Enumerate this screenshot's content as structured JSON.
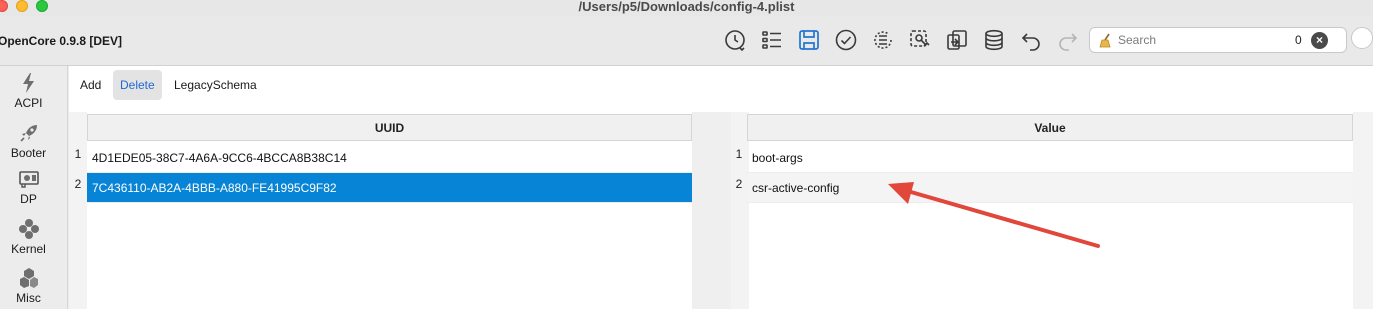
{
  "window": {
    "title": "/Users/p5/Downloads/config-4.plist"
  },
  "toolbar": {
    "app_title": "OpenCore 0.9.8 [DEV]",
    "icons": [
      "clock-icon",
      "list-icon",
      "save-icon",
      "check-icon",
      "list-check-icon",
      "search-config-icon",
      "export-icon",
      "database-icon",
      "undo-icon",
      "redo-icon"
    ],
    "search_placeholder": "Search",
    "search_count": "0",
    "clear_glyph": "×"
  },
  "sidebar": {
    "items": [
      {
        "label": "ACPI",
        "icon": "lightning-icon"
      },
      {
        "label": "Booter",
        "icon": "rocket-icon"
      },
      {
        "label": "DP",
        "icon": "graphics-card-icon"
      },
      {
        "label": "Kernel",
        "icon": "kernel-icon"
      },
      {
        "label": "Misc",
        "icon": "cubes-icon"
      }
    ]
  },
  "actions": {
    "add": "Add",
    "delete": "Delete",
    "legacy": "LegacySchema"
  },
  "left_table": {
    "header": "UUID",
    "rows": [
      {
        "num": "1",
        "value": "4D1EDE05-38C7-4A6A-9CC6-4BCCA8B38C14",
        "selected": false
      },
      {
        "num": "2",
        "value": "7C436110-AB2A-4BBB-A880-FE41995C9F82",
        "selected": true
      }
    ]
  },
  "right_table": {
    "header": "Value",
    "rows": [
      {
        "num": "1",
        "value": "boot-args"
      },
      {
        "num": "2",
        "value": "csr-active-config"
      }
    ]
  },
  "colors": {
    "accent": "#0784d6",
    "arrow": "#e1473a",
    "active_text": "#2069d4"
  }
}
